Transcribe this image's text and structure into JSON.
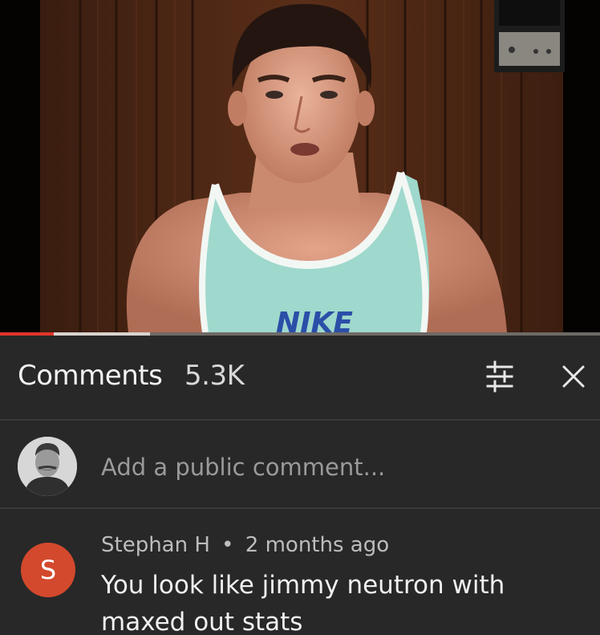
{
  "video": {
    "shirt_logo_text": "NIKE",
    "progress_played_fraction": 0.09,
    "progress_loaded_fraction": 0.25,
    "colors": {
      "played": "#e1352b",
      "loaded": "#d9d3cf",
      "track": "#6f6a66"
    }
  },
  "comments_panel": {
    "title": "Comments",
    "count": "5.3K",
    "sort_icon": "sort-filter-icon",
    "close_icon": "close-icon"
  },
  "add_comment": {
    "placeholder": "Add a public comment...",
    "avatar_icon": "user-avatar-icon"
  },
  "comments": [
    {
      "avatar_letter": "S",
      "avatar_color": "#d3492d",
      "author": "Stephan H",
      "separator": "•",
      "time": "2 months ago",
      "text": "You look like jimmy neutron with maxed out stats"
    }
  ]
}
